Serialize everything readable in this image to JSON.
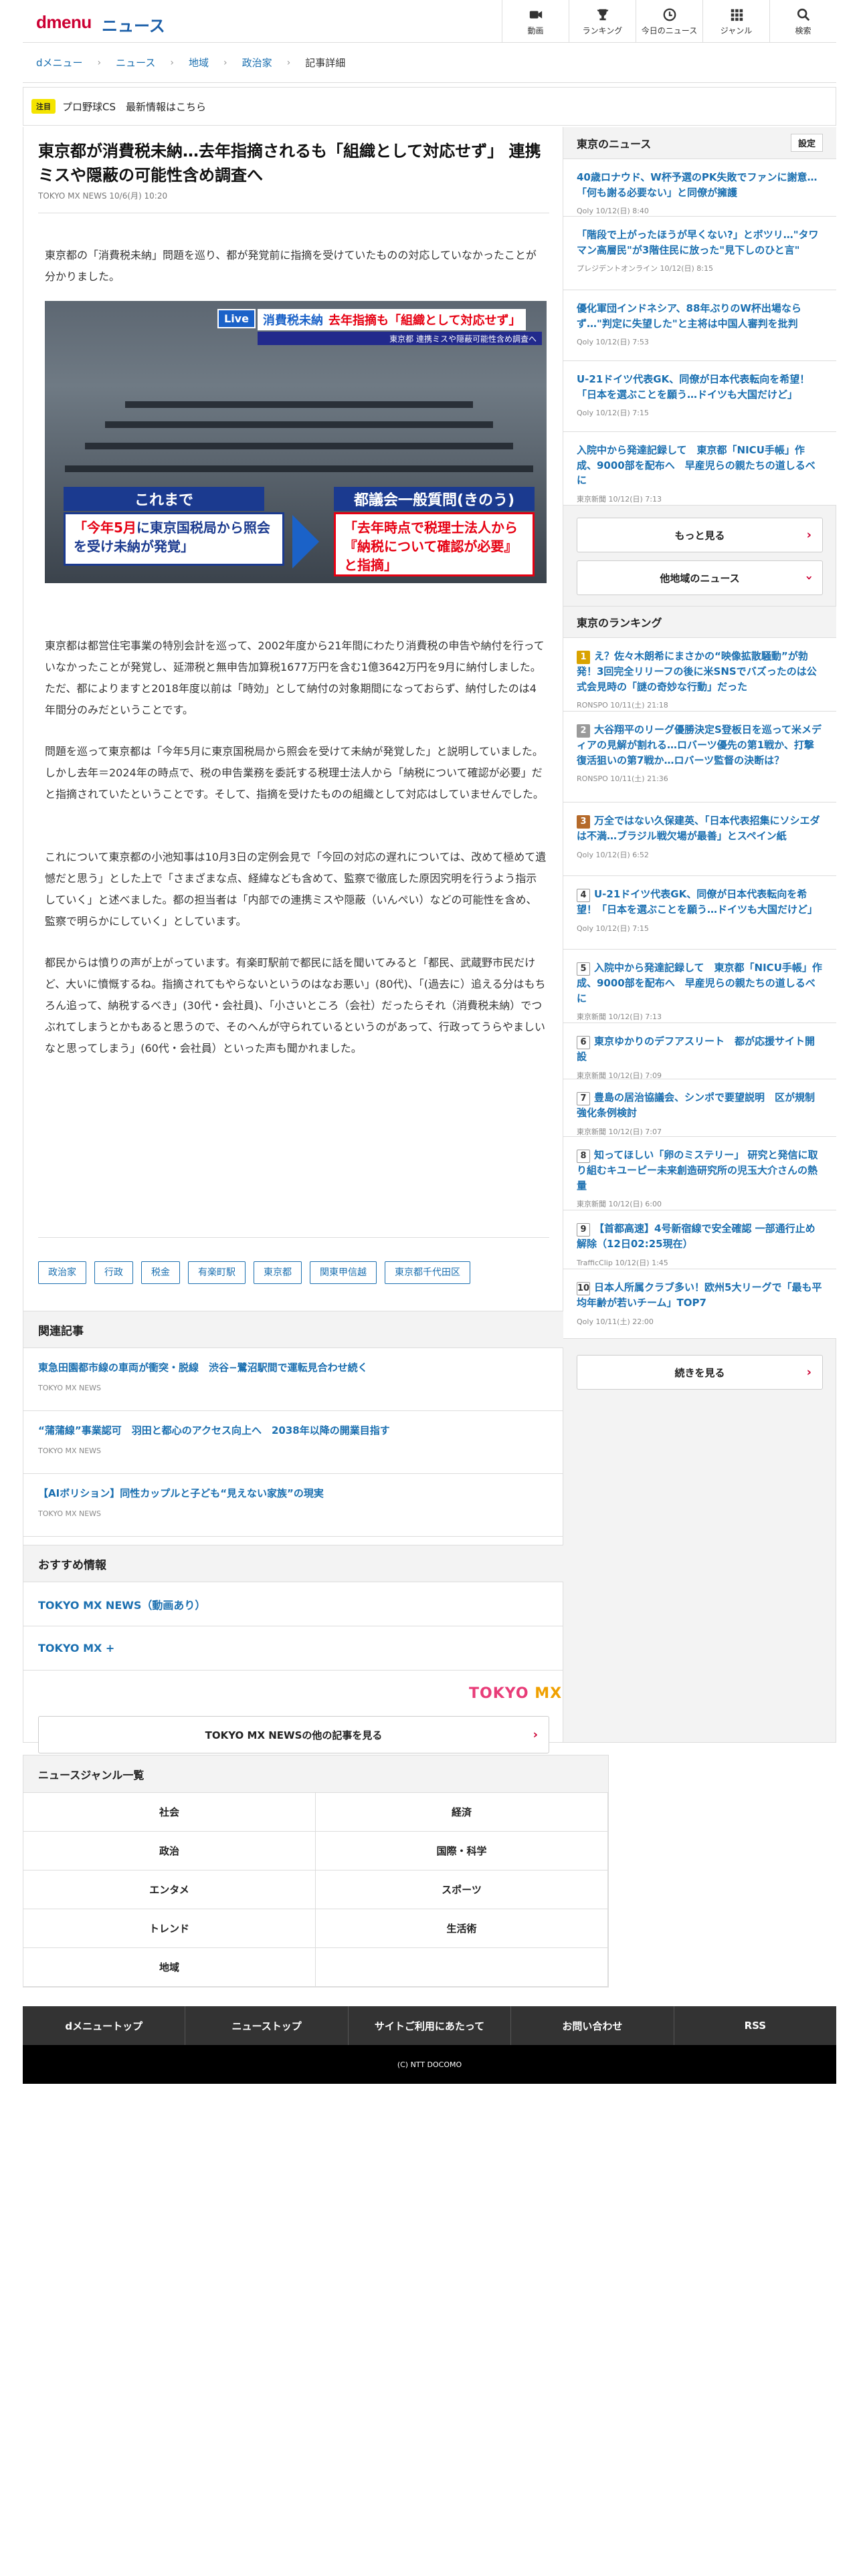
{
  "header": {
    "logo": "dmenu",
    "section": "ニュース",
    "nav": [
      {
        "label": "動画",
        "icon": "video-icon"
      },
      {
        "label": "ランキング",
        "icon": "trophy-icon"
      },
      {
        "label": "今日のニュース",
        "icon": "clock-icon"
      },
      {
        "label": "ジャンル",
        "icon": "grid-icon"
      },
      {
        "label": "検索",
        "icon": "search-icon"
      }
    ]
  },
  "breadcrumb": [
    "dメニュー",
    "ニュース",
    "地域",
    "政治家",
    "記事詳細"
  ],
  "notice": {
    "badge": "注目",
    "text": "プロ野球CS　最新情報はこちら"
  },
  "article": {
    "title": "東京都が消費税未納…去年指摘されるも「組織として対応せず」 連携ミスや隠蔽の可能性含め調査へ",
    "meta": "TOKYO MX NEWS 10/6(月) 10:20",
    "lead": "東京都の「消費税未納」問題を巡り、都が発覚前に指摘を受けていたものの対応していなかったことが分かりました。",
    "video": {
      "live": "Live",
      "topic": "消費税未納",
      "topic_detail": "去年指摘も「組織として対応せず」",
      "sub": "東京都 連携ミスや隠蔽可能性含め調査へ",
      "left_head": "これまで",
      "left_body_red": "「今年5月",
      "left_body": "に東京国税局から照会を受け未納が発覚」",
      "right_head": "都議会一般質問(きのう)",
      "right_body": "「去年時点で税理士法人から『納税について確認が必要』と指摘」"
    },
    "paragraphs": [
      "東京都は都営住宅事業の特別会計を巡って、2002年度から21年間にわたり消費税の申告や納付を行っていなかったことが発覚し、延滞税と無申告加算税1677万円を含む1億3642万円を9月に納付しました。ただ、都によりますと2018年度以前は「時効」として納付の対象期間になっておらず、納付したのは4年間分のみだということです。",
      "問題を巡って東京都は「今年5月に東京国税局から照会を受けて未納が発覚した」と説明していました。しかし去年＝2024年の時点で、税の申告業務を委託する税理士法人から「納税について確認が必要」だと指摘されていたということです。そして、指摘を受けたものの組織として対応はしていませんでした。",
      "これについて東京都の小池知事は10月3日の定例会見で「今回の対応の遅れについては、改めて極めて遺憾だと思う」とした上で「さまざまな点、経緯なども含めて、監察で徹底した原因究明を行うよう指示していく」と述べました。都の担当者は「内部での連携ミスや隠蔽（いんぺい）などの可能性を含め、監察で明らかにしていく」としています。",
      "都民からは憤りの声が上がっています。有楽町駅前で都民に話を聞いてみると「都民、武蔵野市民だけど、大いに憤慨するね。指摘されてもやらないというのはなお悪い」(80代)、「(過去に）追える分はもちろん追って、納税するべき」(30代・会社員)、「小さいところ（会社）だったらそれ（消費税未納）でつぶれてしまうとかもあると思うので、そのへんが守られているというのがあって、行政ってうらやましいなと思ってしまう」(60代・会社員）といった声も聞かれました。"
    ],
    "tags": [
      "政治家",
      "行政",
      "税金",
      "有楽町駅",
      "東京都",
      "関東甲信越",
      "東京都千代田区"
    ]
  },
  "related": {
    "heading": "関連記事",
    "items": [
      {
        "title": "東急田園都市線の車両が衝突・脱線　渋谷−鷺沼駅間で運転見合わせ続く",
        "meta": "TOKYO MX NEWS"
      },
      {
        "title": "“蒲蒲線”事業認可　羽田と都心のアクセス向上へ　2038年以降の開業目指す",
        "meta": "TOKYO MX NEWS"
      },
      {
        "title": "【AIボリション】同性カップルと子ども“見えない家族”の現実",
        "meta": "TOKYO MX NEWS"
      }
    ]
  },
  "recommend": {
    "heading": "おすすめ情報",
    "items": [
      "TOKYO MX NEWS（動画あり）",
      "TOKYO MX +"
    ],
    "logo": "TOKYO MX",
    "more": "TOKYO MX NEWSの他の記事を見る"
  },
  "sidebar": {
    "local_heading": "東京のニュース",
    "setting": "設定",
    "local": [
      {
        "title": "40歳ロナウド、W杯予選のPK失敗でファンに謝意…「何も謝る必要ない」と同僚が擁護",
        "meta": "Qoly 10/12(日) 8:40"
      },
      {
        "title": "「階段で上がったほうが早くない?」とボツリ…\"タワマン高層民\"が3階住民に放った\"見下しのひと言\"",
        "meta": "プレジデントオンライン 10/12(日) 8:15"
      },
      {
        "title": "優化軍団インドネシア、88年ぶりのW杯出場ならず…\"判定に失望した\"と主将は中国人審判を批判",
        "meta": "Qoly 10/12(日) 7:53"
      },
      {
        "title": "U-21ドイツ代表GK、同僚が日本代表転向を希望！「日本を選ぶことを願う…ドイツも大国だけど」",
        "meta": "Qoly 10/12(日) 7:15"
      },
      {
        "title": "入院中から発達記録して　東京都「NICU手帳」作成、9000部を配布へ　早産児らの親たちの道しるべに",
        "meta": "東京新聞 10/12(日) 7:13"
      }
    ],
    "more": "もっと見る",
    "regional": "他地域のニュース",
    "ranking_heading": "東京のランキング",
    "ranking": [
      {
        "rank": "1",
        "title": "え？佐々木朗希にまさかの“映像拡散騒動”が勃発！3回完全リリーフの後に米SNSでバズったのは公式会見時の「謎の奇妙な行動」だった",
        "meta": "RONSPO 10/11(土) 21:18"
      },
      {
        "rank": "2",
        "title": "大谷翔平のリーグ優勝決定S登板日を巡って米メディアの見解が割れる…ロバーツ優先の第1戦か、打撃復活狙いの第7戦か…ロバーツ監督の決断は？",
        "meta": "RONSPO 10/11(土) 21:36"
      },
      {
        "rank": "3",
        "title": "万全ではない久保建英、「日本代表招集にソシエダは不満…ブラジル戦欠場が最善」とスペイン紙",
        "meta": "Qoly 10/12(日) 6:52"
      },
      {
        "rank": "4",
        "title": "U-21ドイツ代表GK、同僚が日本代表転向を希望！「日本を選ぶことを願う…ドイツも大国だけど」",
        "meta": "Qoly 10/12(日) 7:15"
      },
      {
        "rank": "5",
        "title": "入院中から発達記録して　東京都「NICU手帳」作成、9000部を配布へ　早産児らの親たちの道しるべに",
        "meta": "東京新聞 10/12(日) 7:13"
      },
      {
        "rank": "6",
        "title": "東京ゆかりのデフアスリート　都が応援サイト開設",
        "meta": "東京新聞 10/12(日) 7:09"
      },
      {
        "rank": "7",
        "title": "豊島の居治協議会、シンポで要望説明　区が規制強化条例検討",
        "meta": "東京新聞 10/12(日) 7:07"
      },
      {
        "rank": "8",
        "title": "知ってほしい「卵のミステリー」 研究と発信に取り組むキユーピー未来創造研究所の児玉大介さんの熱量",
        "meta": "東京新聞 10/12(日) 6:00"
      },
      {
        "rank": "9",
        "title": "【首都高速】4号新宿線で安全確認 一部通行止め解除（12日02:25現在）",
        "meta": "TrafficClip 10/12(日) 1:45"
      },
      {
        "rank": "10",
        "title": "日本人所属クラブ多い！欧州5大リーグで「最も平均年齢が若いチーム」TOP7",
        "meta": "Qoly 10/11(土) 22:00"
      }
    ],
    "ranking_more": "続きを見る"
  },
  "genre": {
    "heading": "ニュースジャンル一覧",
    "items": [
      "社会",
      "経済",
      "政治",
      "国際・科学",
      "エンタメ",
      "スポーツ",
      "トレンド",
      "生活術",
      "地域",
      ""
    ]
  },
  "footer": {
    "links": [
      "dメニュートップ",
      "ニューストップ",
      "サイトご利用にあたって",
      "お問い合わせ",
      "RSS"
    ],
    "copyright": "(C) NTT DOCOMO"
  },
  "colors": {
    "brand": "#cc0033",
    "link": "#1a6fb0",
    "badge": "#f4e400"
  }
}
